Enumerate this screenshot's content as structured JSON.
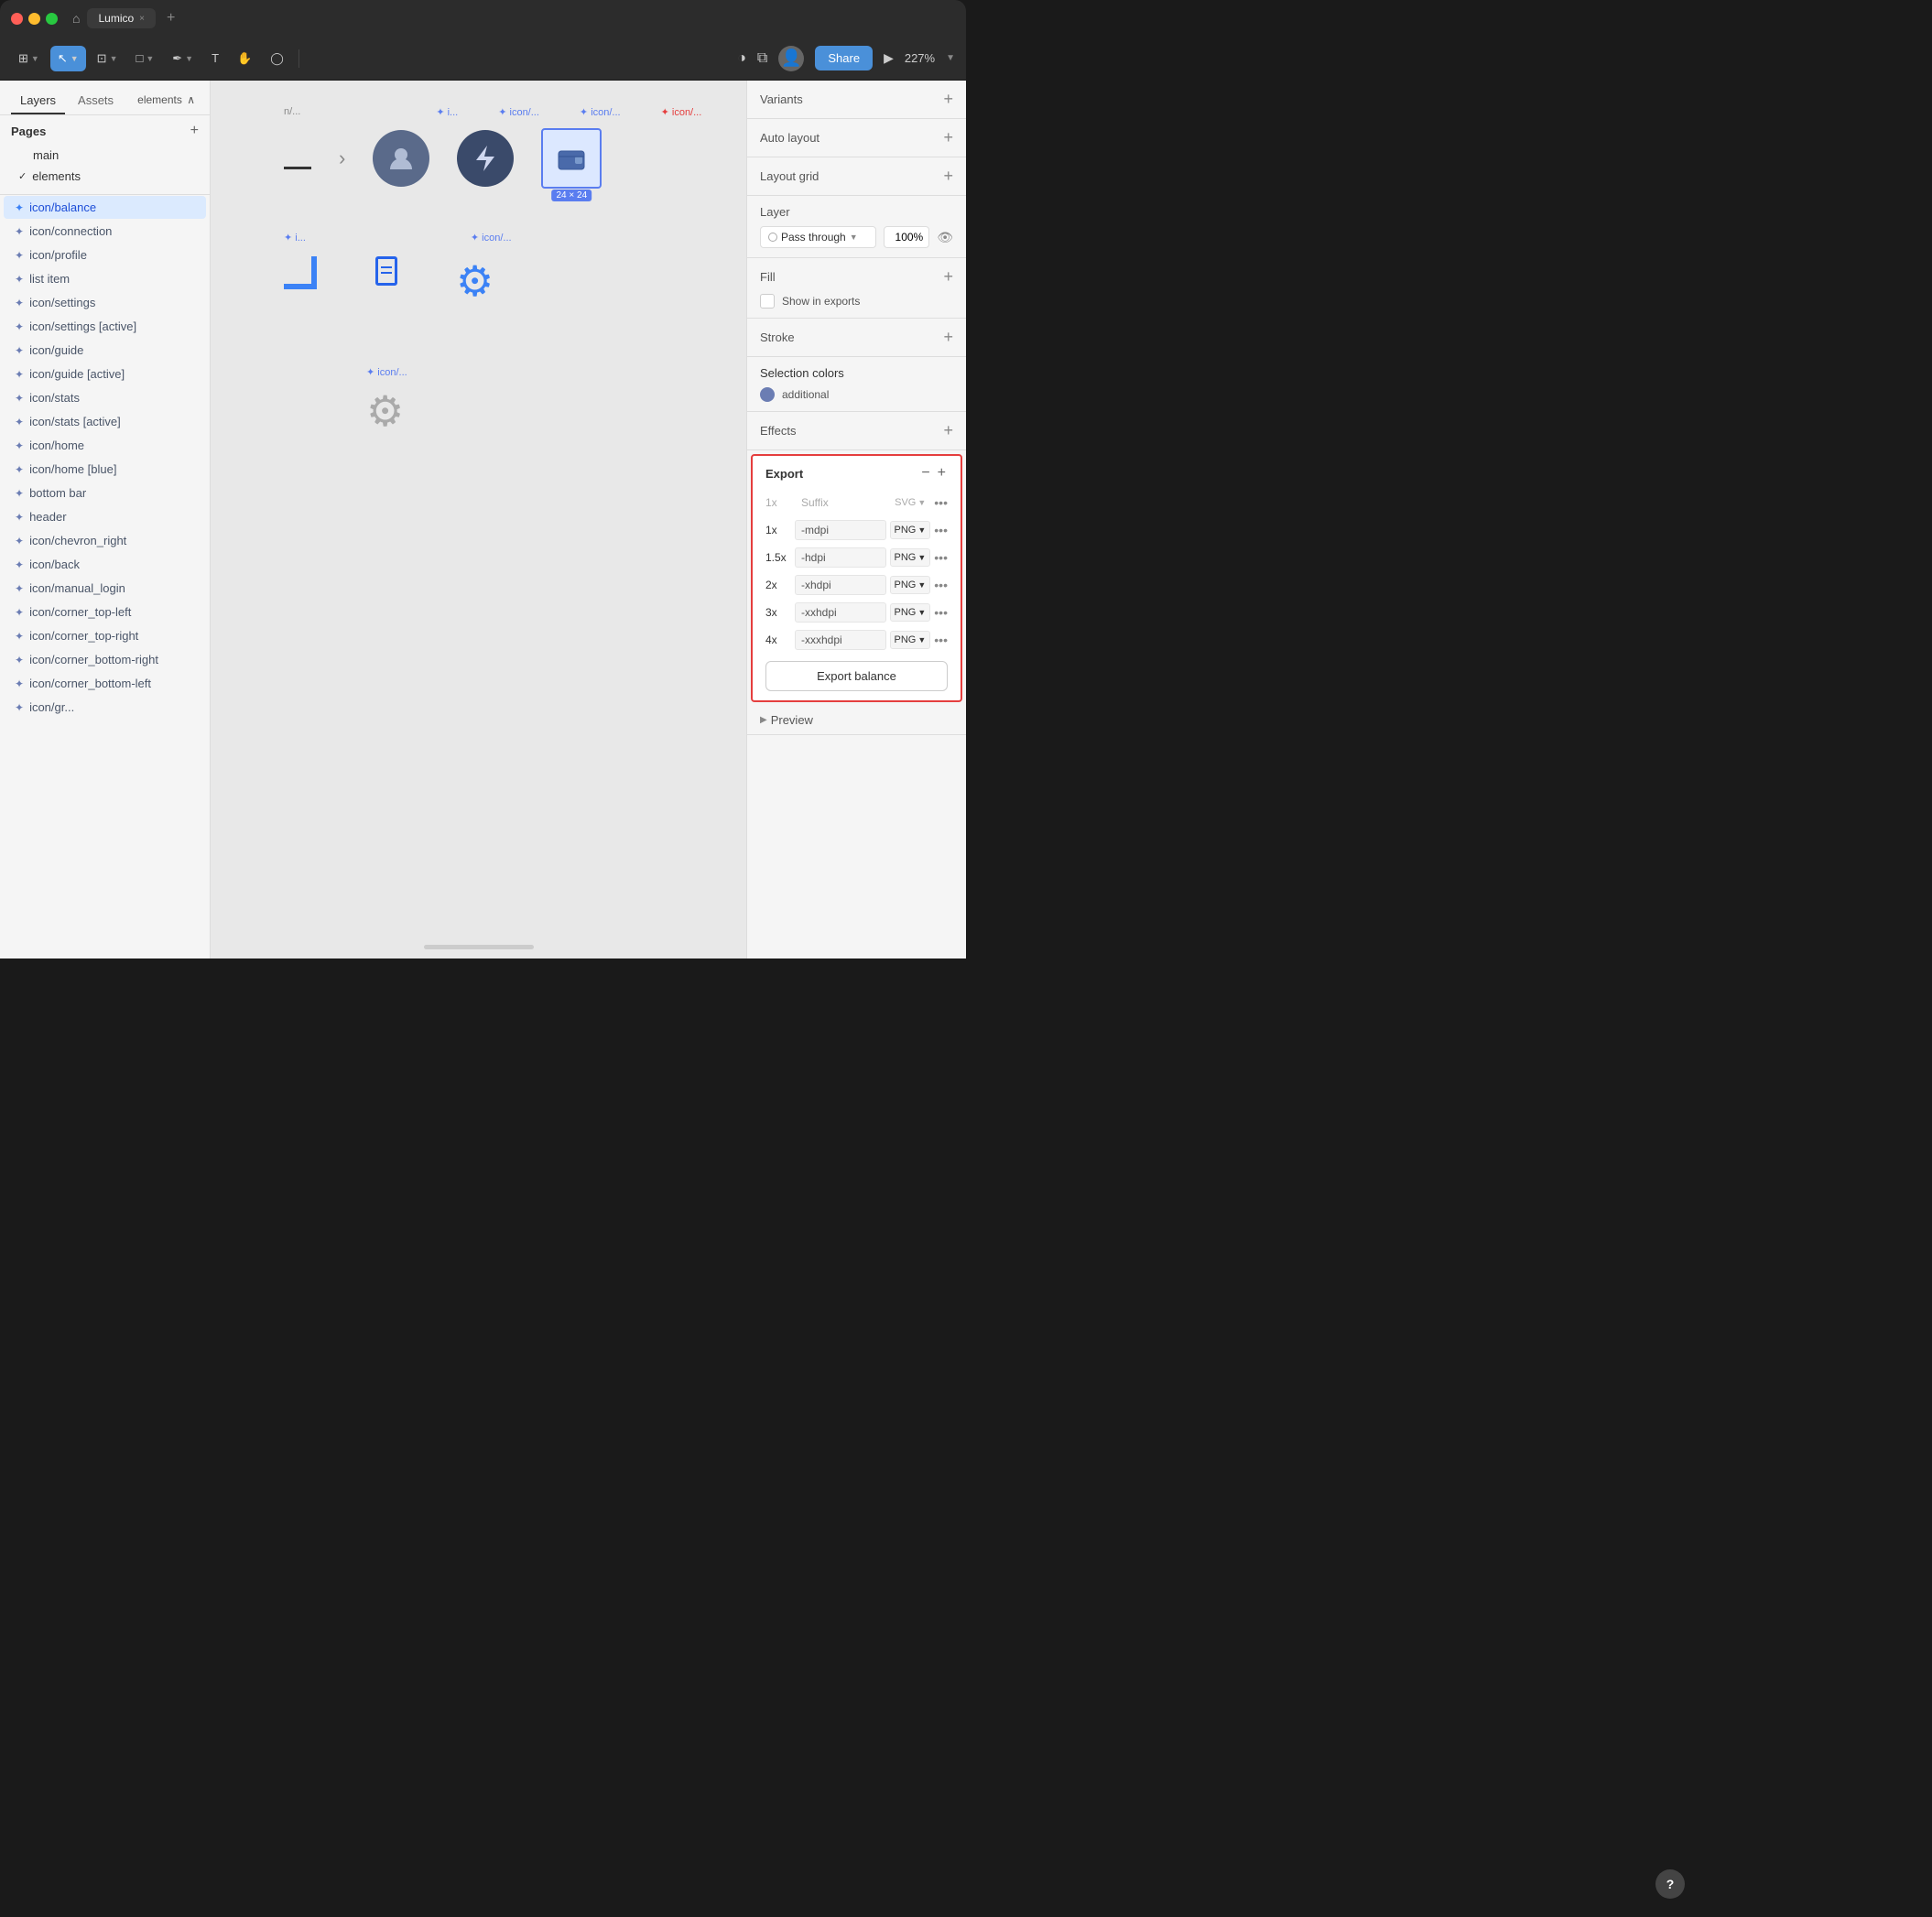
{
  "titlebar": {
    "title": "Lumico",
    "tab_close": "×",
    "tab_add": "+"
  },
  "toolbar": {
    "tools": [
      {
        "id": "grid",
        "label": "⊞",
        "active": false
      },
      {
        "id": "select",
        "label": "↖",
        "active": true
      },
      {
        "id": "frame",
        "label": "⊡",
        "active": false
      },
      {
        "id": "shape",
        "label": "□",
        "active": false
      },
      {
        "id": "pen",
        "label": "✒",
        "active": false
      },
      {
        "id": "text",
        "label": "T",
        "active": false
      },
      {
        "id": "hand",
        "label": "✋",
        "active": false
      },
      {
        "id": "comment",
        "label": "◯",
        "active": false
      }
    ],
    "share_label": "Share",
    "zoom_level": "227%",
    "play_icon": "▶"
  },
  "left_panel": {
    "tabs": [
      {
        "id": "layers",
        "label": "Layers",
        "active": true
      },
      {
        "id": "assets",
        "label": "Assets",
        "active": false
      }
    ],
    "elements_label": "elements",
    "pages": {
      "title": "Pages",
      "items": [
        {
          "id": "main",
          "label": "main",
          "active": false
        },
        {
          "id": "elements",
          "label": "elements",
          "active": true
        }
      ]
    },
    "layers": [
      {
        "id": "icon-balance",
        "label": "icon/balance",
        "active": true
      },
      {
        "id": "icon-connection",
        "label": "icon/connection",
        "active": false
      },
      {
        "id": "icon-profile",
        "label": "icon/profile",
        "active": false
      },
      {
        "id": "list-item",
        "label": "list item",
        "active": false
      },
      {
        "id": "icon-settings",
        "label": "icon/settings",
        "active": false
      },
      {
        "id": "icon-settings-active",
        "label": "icon/settings [active]",
        "active": false
      },
      {
        "id": "icon-guide",
        "label": "icon/guide",
        "active": false
      },
      {
        "id": "icon-guide-active",
        "label": "icon/guide [active]",
        "active": false
      },
      {
        "id": "icon-stats",
        "label": "icon/stats",
        "active": false
      },
      {
        "id": "icon-stats-active",
        "label": "icon/stats [active]",
        "active": false
      },
      {
        "id": "icon-home",
        "label": "icon/home",
        "active": false
      },
      {
        "id": "icon-home-blue",
        "label": "icon/home [blue]",
        "active": false
      },
      {
        "id": "bottom-bar",
        "label": "bottom bar",
        "active": false
      },
      {
        "id": "header",
        "label": "header",
        "active": false
      },
      {
        "id": "icon-chevron-right",
        "label": "icon/chevron_right",
        "active": false
      },
      {
        "id": "icon-back",
        "label": "icon/back",
        "active": false
      },
      {
        "id": "icon-manual-login",
        "label": "icon/manual_login",
        "active": false
      },
      {
        "id": "icon-corner-top-left",
        "label": "icon/corner_top-left",
        "active": false
      },
      {
        "id": "icon-corner-top-right",
        "label": "icon/corner_top-right",
        "active": false
      },
      {
        "id": "icon-corner-bottom-right",
        "label": "icon/corner_bottom-right",
        "active": false
      },
      {
        "id": "icon-corner-bottom-left",
        "label": "icon/corner_bottom-left",
        "active": false
      },
      {
        "id": "icon-gr",
        "label": "icon/gr...",
        "active": false
      }
    ]
  },
  "canvas": {
    "top_labels": [
      "n/...",
      "i...",
      "icon/...",
      "icon/...",
      "icon/..."
    ],
    "size_label": "24 × 24"
  },
  "right_panel": {
    "variants_title": "Variants",
    "auto_layout_title": "Auto layout",
    "layout_grid_title": "Layout grid",
    "layer_section": {
      "title": "Layer",
      "blend_mode": "Pass through",
      "opacity": "100%",
      "visibility_icon": "👁"
    },
    "fill_section": {
      "title": "Fill",
      "show_in_exports_label": "Show in exports"
    },
    "stroke_section": {
      "title": "Stroke"
    },
    "selection_colors": {
      "title": "Selection colors",
      "items": [
        {
          "color": "#6b7db3",
          "label": "additional"
        }
      ]
    },
    "effects_section": {
      "title": "Effects"
    },
    "export_section": {
      "title": "Export",
      "columns": {
        "scale": "1x",
        "suffix": "Suffix",
        "format": "SVG"
      },
      "rows": [
        {
          "scale": "1x",
          "suffix": "",
          "format": "SVG",
          "is_header": true
        },
        {
          "scale": "1x",
          "suffix": "-mdpi",
          "format": "PNG"
        },
        {
          "scale": "1.5x",
          "suffix": "-hdpi",
          "format": "PNG"
        },
        {
          "scale": "2x",
          "suffix": "-xhdpi",
          "format": "PNG"
        },
        {
          "scale": "3x",
          "suffix": "-xxhdpi",
          "format": "PNG"
        },
        {
          "scale": "4x",
          "suffix": "-xxxhdpi",
          "format": "PNG"
        }
      ],
      "export_btn_label": "Export balance",
      "minus_icon": "−",
      "plus_icon": "+"
    },
    "preview_section": {
      "title": "Preview",
      "arrow": "▶"
    }
  }
}
